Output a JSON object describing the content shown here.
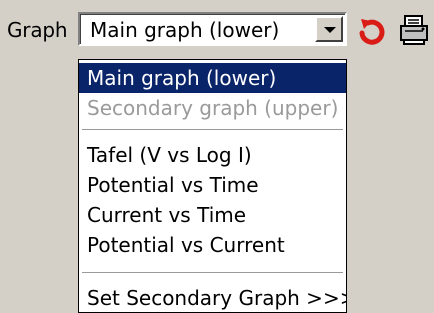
{
  "toolbar": {
    "graph_label": "Graph",
    "graph_select": {
      "value": "Main graph (lower)"
    }
  },
  "dropdown": {
    "items": [
      {
        "label": "Main graph (lower)",
        "state": "selected"
      },
      {
        "label": "Secondary graph (upper)",
        "state": "disabled"
      },
      {
        "label": "Tafel (V vs Log I)",
        "state": "normal"
      },
      {
        "label": "Potential vs Time",
        "state": "normal"
      },
      {
        "label": "Current vs Time",
        "state": "normal"
      },
      {
        "label": "Potential vs Current",
        "state": "normal"
      },
      {
        "label": "Set Secondary Graph >>>",
        "state": "normal"
      }
    ]
  },
  "icons": {
    "dropdown": "chevron-down-icon",
    "refresh": "refresh-icon",
    "print": "printer-icon"
  },
  "colors": {
    "selection": "#0a246a",
    "refresh": "#d91d16",
    "disabled_text": "#9a9a9a"
  }
}
